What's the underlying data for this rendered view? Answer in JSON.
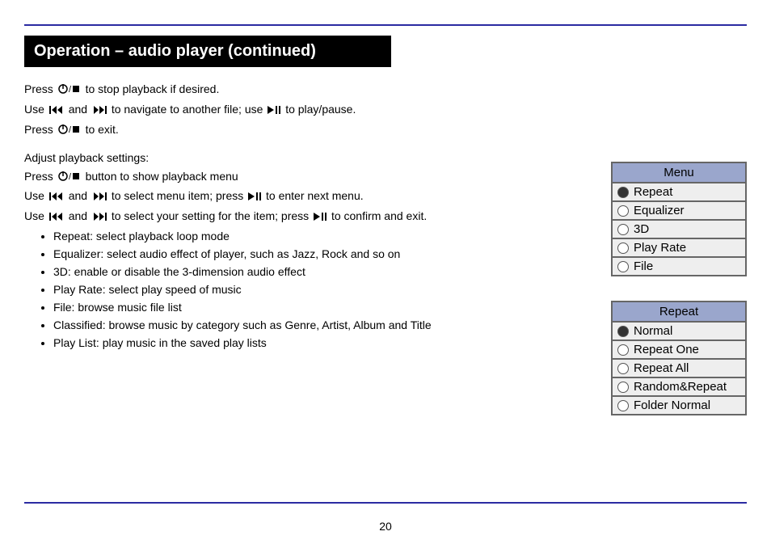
{
  "title": "Operation – audio player (continued)",
  "lines": {
    "l1a": "Press ",
    "l1b": " to stop playback if desired.",
    "l2a": "Use ",
    "l2b": " and ",
    "l2c": " to navigate to another file; use ",
    "l2d": " to play/pause.",
    "l3a": "Press ",
    "l3b": " to exit.",
    "sub1": "Adjust playback settings:",
    "s1a": "Press ",
    "s1b": " button to show playback menu",
    "s2a": "Use ",
    "s2b": " and ",
    "s2c": " to select menu item; press ",
    "s2d": " to enter next menu.",
    "s3a": "Use ",
    "s3b": " and ",
    "s3c": " to select your setting for the item; press ",
    "s3d": " to confirm and exit."
  },
  "bullets": [
    "Repeat: select playback loop mode",
    "Equalizer: select audio effect of player, such as Jazz, Rock and so on",
    "3D: enable or disable the 3-dimension audio effect",
    "Play Rate: select play speed of music",
    "File: browse music file list",
    "Classified: browse music by category such as Genre, Artist, Album and Title",
    "Play List: play music in the saved play lists"
  ],
  "menu1": {
    "title": "Menu",
    "items": [
      {
        "label": "Repeat",
        "selected": true
      },
      {
        "label": "Equalizer",
        "selected": false
      },
      {
        "label": "3D",
        "selected": false
      },
      {
        "label": "Play Rate",
        "selected": false
      },
      {
        "label": "File",
        "selected": false
      }
    ]
  },
  "menu2": {
    "title": "Repeat",
    "items": [
      {
        "label": "Normal",
        "selected": true
      },
      {
        "label": "Repeat One",
        "selected": false
      },
      {
        "label": "Repeat All",
        "selected": false
      },
      {
        "label": "Random&Repeat",
        "selected": false
      },
      {
        "label": "Folder Normal",
        "selected": false
      }
    ]
  },
  "pageNumber": "20"
}
